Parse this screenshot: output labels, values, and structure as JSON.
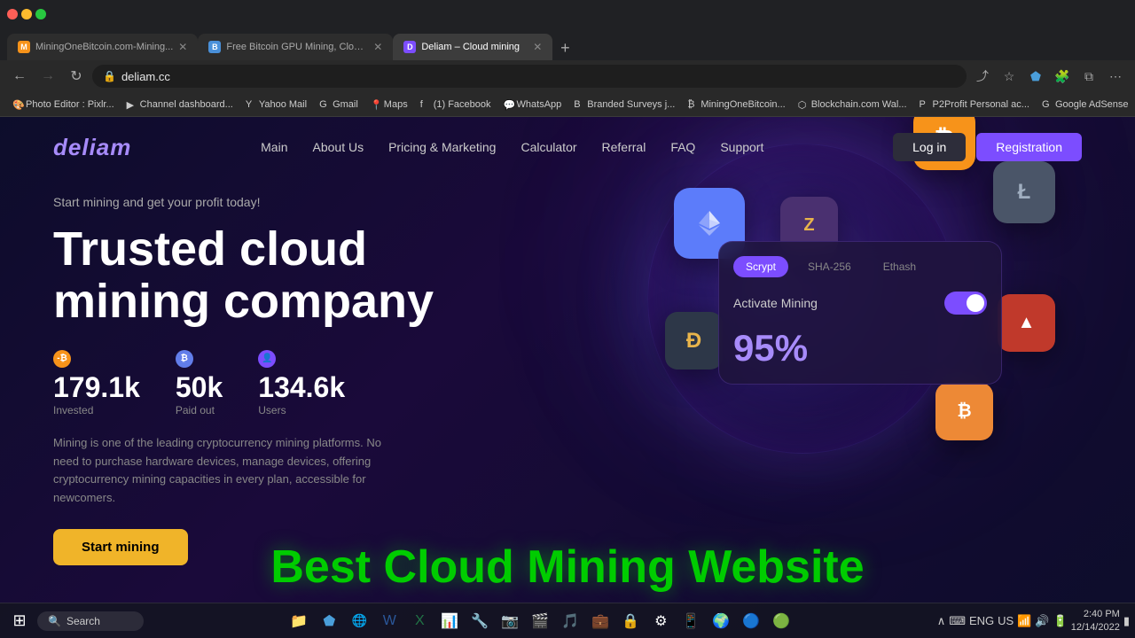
{
  "browser": {
    "tabs": [
      {
        "id": 1,
        "title": "MiningOneBitcoin.com-Mining...",
        "active": false,
        "favicon_color": "#f7931a",
        "favicon_letter": "M"
      },
      {
        "id": 2,
        "title": "Free Bitcoin GPU Mining, Cloud...",
        "active": false,
        "favicon_color": "#4a90d9",
        "favicon_letter": "B"
      },
      {
        "id": 3,
        "title": "Deliam – Cloud mining",
        "active": true,
        "favicon_color": "#7c4dff",
        "favicon_letter": "D"
      }
    ],
    "address": "deliam.cc",
    "new_tab_label": "+"
  },
  "bookmarks": [
    {
      "label": "Photo Editor : Pixlr...",
      "favicon": "🎨"
    },
    {
      "label": "Channel dashboard...",
      "favicon": "▶"
    },
    {
      "label": "Yahoo Mail",
      "favicon": "Y"
    },
    {
      "label": "Gmail",
      "favicon": "G"
    },
    {
      "label": "Maps",
      "favicon": "📍"
    },
    {
      "label": "(1) Facebook",
      "favicon": "f"
    },
    {
      "label": "WhatsApp",
      "favicon": "💬"
    },
    {
      "label": "Branded Surveys j...",
      "favicon": "B"
    },
    {
      "label": "MiningOneBitcoin...",
      "favicon": "₿"
    },
    {
      "label": "Blockchain.com Wal...",
      "favicon": "⬡"
    },
    {
      "label": "P2Profit Personal ac...",
      "favicon": "P"
    },
    {
      "label": "Google AdSense",
      "favicon": "G"
    }
  ],
  "site": {
    "logo": "deliam",
    "nav": {
      "items": [
        "Main",
        "About Us",
        "Pricing & Marketing",
        "Calculator",
        "Referral",
        "FAQ",
        "Support"
      ]
    },
    "actions": {
      "login": "Log in",
      "register": "Registration"
    },
    "hero": {
      "subtitle": "Start mining and get your profit today!",
      "title_line1": "Trusted cloud",
      "title_line2": "mining company",
      "stats": [
        {
          "icon": "₿",
          "icon_type": "btc",
          "value": "179.1k",
          "label": "Invested"
        },
        {
          "icon": "₿",
          "icon_type": "eth",
          "value": "50k",
          "label": "Paid out"
        },
        {
          "icon": "👤",
          "icon_type": "user",
          "value": "134.6k",
          "label": "Users"
        }
      ],
      "description": "Mining is one of the leading cryptocurrency mining platforms. No need to purchase hardware devices, manage devices, offering cryptocurrency mining capacities in every plan, accessible for newcomers.",
      "cta": "Start mining"
    },
    "mining_card": {
      "tabs": [
        "Scrypt",
        "SHA-256",
        "Ethash"
      ],
      "active_tab": "Scrypt",
      "activate_label": "Activate Mining",
      "percent": "95%"
    }
  },
  "overlay": {
    "text": "Best Cloud Mining Website"
  },
  "taskbar": {
    "search_placeholder": "Search",
    "system": {
      "lang": "ENG",
      "region": "US",
      "time": "2:40 PM",
      "date": "12/14/2022"
    }
  },
  "icons": {
    "search": "🔍",
    "windows": "⊞",
    "back": "←",
    "forward": "→",
    "refresh": "↻",
    "lock": "🔒"
  }
}
